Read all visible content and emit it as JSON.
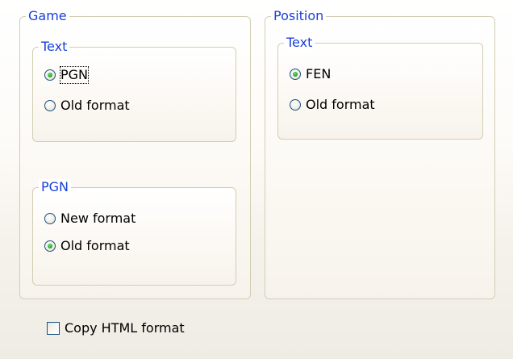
{
  "game": {
    "title": "Game",
    "text_group": {
      "title": "Text",
      "options": [
        "PGN",
        "Old format"
      ],
      "selected": "PGN"
    },
    "pgn_group": {
      "title": "PGN",
      "options": [
        "New format",
        "Old format"
      ],
      "selected": "Old format"
    }
  },
  "position": {
    "title": "Position",
    "text_group": {
      "title": "Text",
      "options": [
        "FEN",
        "Old format"
      ],
      "selected": "FEN"
    }
  },
  "copy_html": {
    "label": "Copy HTML format",
    "checked": false
  }
}
